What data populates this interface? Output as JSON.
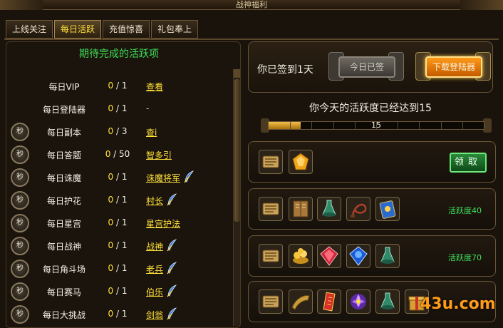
{
  "window": {
    "title": "战神福利"
  },
  "tabs": [
    {
      "label": "上线关注",
      "active": false
    },
    {
      "label": "每日活跃",
      "active": true
    },
    {
      "label": "充值惊喜",
      "active": false
    },
    {
      "label": "礼包奉上",
      "active": false
    }
  ],
  "left": {
    "heading": "期待完成的活跃项",
    "sec_label": "秒",
    "rows": [
      {
        "name": "每日VIP",
        "cur": "0",
        "total": "1",
        "action": "查看",
        "sec": false,
        "feather": false
      },
      {
        "name": "每日登陆器",
        "cur": "0",
        "total": "1",
        "action": "-",
        "sec": false,
        "feather": false
      },
      {
        "name": "每日副本",
        "cur": "0",
        "total": "3",
        "action": "查i",
        "sec": true,
        "feather": false
      },
      {
        "name": "每日答题",
        "cur": "0",
        "total": "50",
        "action": "智多引",
        "sec": true,
        "feather": false
      },
      {
        "name": "每日诛魔",
        "cur": "0",
        "total": "1",
        "action": "诛魔将军",
        "sec": true,
        "feather": true
      },
      {
        "name": "每日护花",
        "cur": "0",
        "total": "1",
        "action": "村长",
        "sec": true,
        "feather": true
      },
      {
        "name": "每日星宫",
        "cur": "0",
        "total": "1",
        "action": "星宫护法",
        "sec": true,
        "feather": false
      },
      {
        "name": "每日战神",
        "cur": "0",
        "total": "1",
        "action": "战神",
        "sec": true,
        "feather": true
      },
      {
        "name": "每日角斗场",
        "cur": "0",
        "total": "1",
        "action": "老兵",
        "sec": true,
        "feather": true
      },
      {
        "name": "每日赛马",
        "cur": "0",
        "total": "1",
        "action": "伯乐",
        "sec": true,
        "feather": true
      },
      {
        "name": "每日大挑战",
        "cur": "0",
        "total": "1",
        "action": "剑翁",
        "sec": true,
        "feather": true
      }
    ]
  },
  "signin": {
    "text": "你已签到1天",
    "signed_button": "今日已签",
    "download_button": "下载登陆器"
  },
  "activity": {
    "text": "你今天的活跃度已经达到15",
    "value": 15,
    "max": 100,
    "bar_label": "15"
  },
  "rewards": [
    {
      "items": [
        "scroll-icon",
        "amber-gem-icon"
      ],
      "claim_label": "领取",
      "requirement": ""
    },
    {
      "items": [
        "scroll-icon",
        "book-icon",
        "potion-icon",
        "whip-icon",
        "card-icon"
      ],
      "claim_label": "",
      "requirement": "活跃度40"
    },
    {
      "items": [
        "scroll-icon",
        "gold-icon",
        "ruby-icon",
        "sapphire-icon",
        "potion-icon"
      ],
      "claim_label": "",
      "requirement": "活跃度70"
    },
    {
      "items": [
        "scroll-icon",
        "horn-icon",
        "talisman-icon",
        "lotus-icon",
        "potion-icon",
        "giftbox-icon"
      ],
      "claim_label": "",
      "requirement": ""
    }
  ],
  "watermark": "43u.com",
  "colors": {
    "accent": "#ffe13a",
    "green": "#3fe05a",
    "orange": "#ff9a1a"
  }
}
